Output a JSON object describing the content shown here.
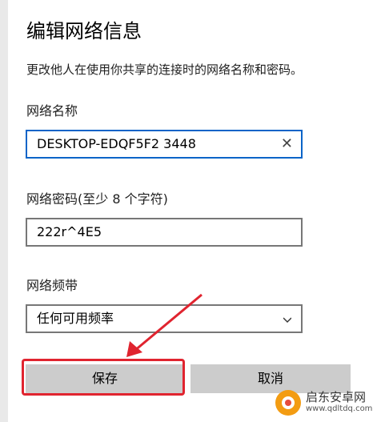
{
  "dialog": {
    "title": "编辑网络信息",
    "description": "更改他人在使用你共享的连接时的网络名称和密码。",
    "network_name_label": "网络名称",
    "network_name_value": "DESKTOP-EDQF5F2 3448",
    "password_label": "网络密码(至少 8 个字符)",
    "password_value": "222r^4E5",
    "band_label": "网络频带",
    "band_value": "任何可用频率",
    "save_label": "保存",
    "cancel_label": "取消"
  },
  "watermark": {
    "text": "启东安卓网",
    "url": "www.qdltdq.com"
  },
  "colors": {
    "accent": "#0a64c8",
    "highlight": "#e0242f",
    "button": "#cccccc"
  }
}
